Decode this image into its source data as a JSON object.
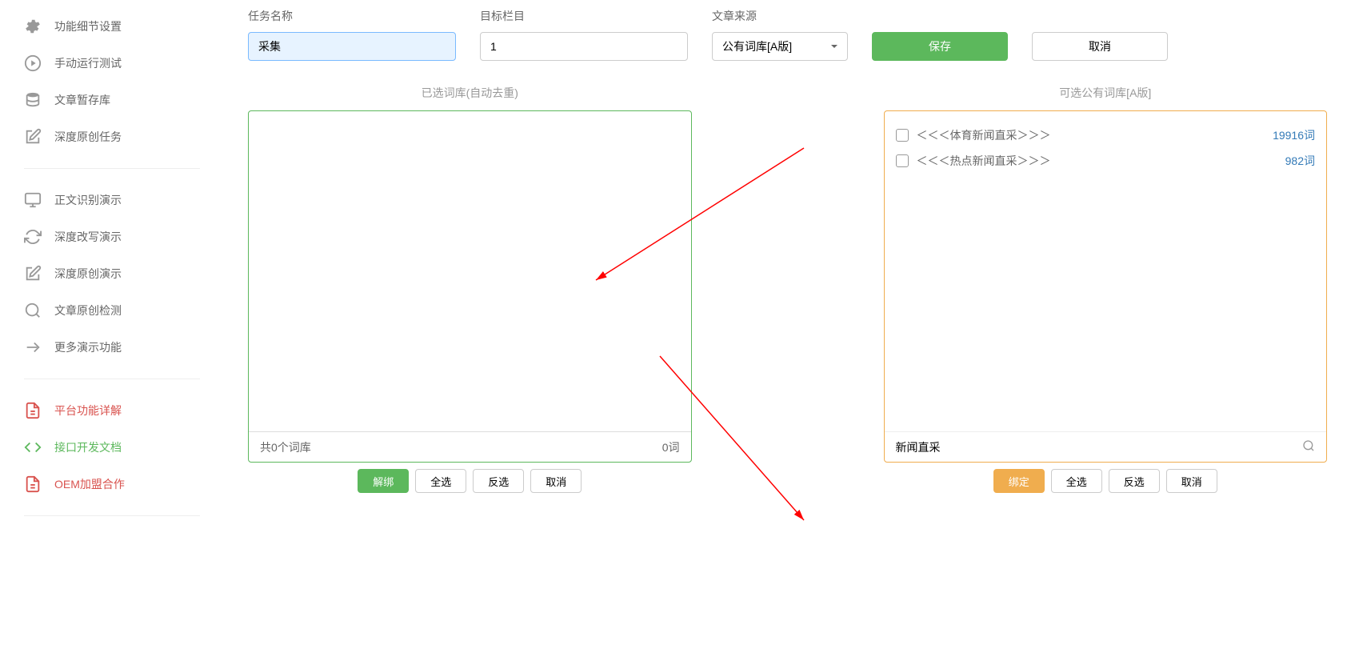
{
  "sidebar": {
    "group1": [
      {
        "icon": "cogs",
        "label": "功能细节设置"
      },
      {
        "icon": "play",
        "label": "手动运行测试"
      },
      {
        "icon": "database",
        "label": "文章暂存库"
      },
      {
        "icon": "edit",
        "label": "深度原创任务"
      }
    ],
    "group2": [
      {
        "icon": "desktop",
        "label": "正文识别演示"
      },
      {
        "icon": "refresh",
        "label": "深度改写演示"
      },
      {
        "icon": "edit",
        "label": "深度原创演示"
      },
      {
        "icon": "search",
        "label": "文章原创检测"
      },
      {
        "icon": "share",
        "label": "更多演示功能"
      }
    ],
    "group3": [
      {
        "icon": "file",
        "label": "平台功能详解",
        "cls": "red"
      },
      {
        "icon": "code",
        "label": "接口开发文档",
        "cls": "green"
      },
      {
        "icon": "file",
        "label": "OEM加盟合作",
        "cls": "red"
      }
    ]
  },
  "form": {
    "task_name_label": "任务名称",
    "task_name_value": "采集",
    "target_col_label": "目标栏目",
    "target_col_value": "1",
    "source_label": "文章来源",
    "source_value": "公有词库[A版]",
    "save_label": "保存",
    "cancel_label": "取消"
  },
  "left_panel": {
    "title": "已选词库(自动去重)",
    "footer_left": "共0个词库",
    "footer_right": "0词",
    "btn_unbind": "解绑",
    "btn_all": "全选",
    "btn_invert": "反选",
    "btn_cancel": "取消"
  },
  "right_panel": {
    "title": "可选公有词库[A版]",
    "items": [
      {
        "label": "＜＜＜体育新闻直采＞＞＞",
        "count": "19916词"
      },
      {
        "label": "＜＜＜热点新闻直采＞＞＞",
        "count": "982词"
      }
    ],
    "search_value": "新闻直采",
    "btn_bind": "绑定",
    "btn_all": "全选",
    "btn_invert": "反选",
    "btn_cancel": "取消"
  }
}
